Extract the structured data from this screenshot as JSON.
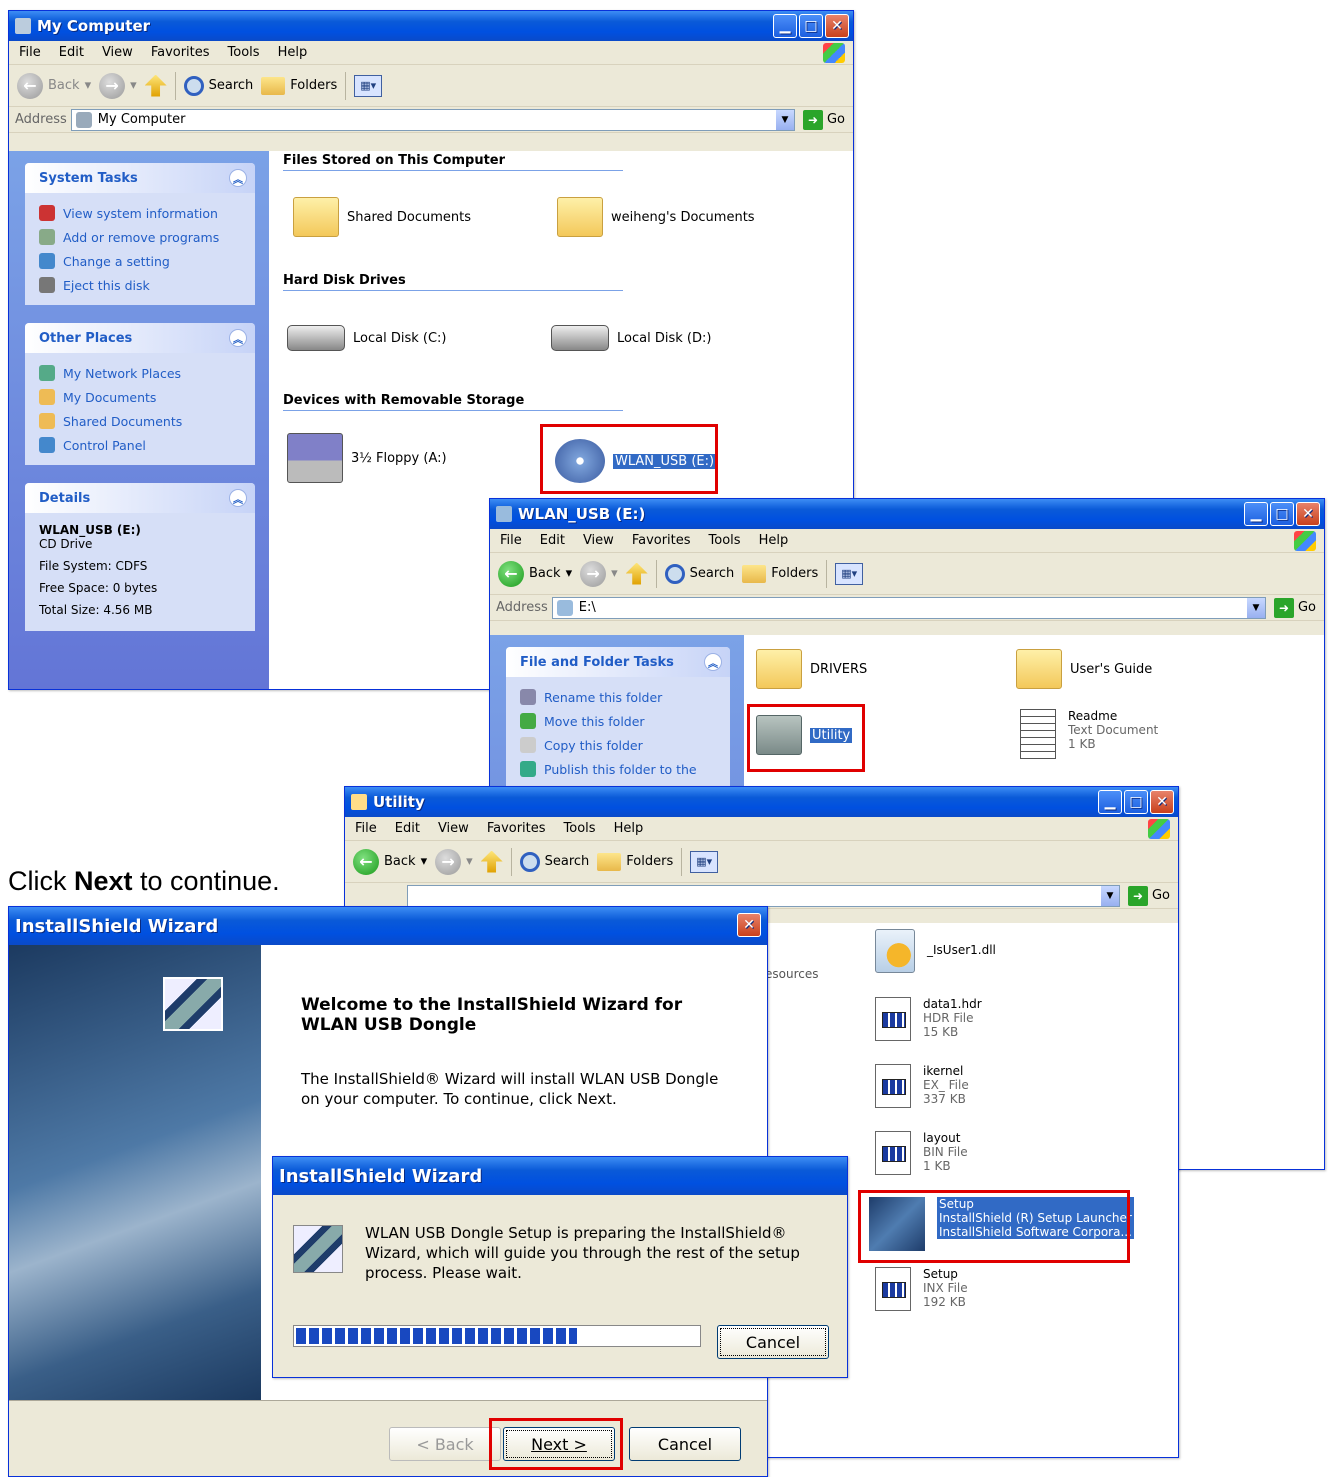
{
  "caption": {
    "pre": "Click ",
    "bold": "Next",
    "post": " to continue."
  },
  "mycomputer": {
    "title": "My Computer",
    "menu": [
      "File",
      "Edit",
      "View",
      "Favorites",
      "Tools",
      "Help"
    ],
    "toolbar": {
      "back": "Back",
      "search": "Search",
      "folders": "Folders"
    },
    "address": {
      "label": "Address",
      "value": "My Computer",
      "go": "Go"
    },
    "system_tasks": {
      "title": "System Tasks",
      "items": [
        "View system information",
        "Add or remove programs",
        "Change a setting",
        "Eject this disk"
      ]
    },
    "other_places": {
      "title": "Other Places",
      "items": [
        "My Network Places",
        "My Documents",
        "Shared Documents",
        "Control Panel"
      ]
    },
    "details": {
      "title": "Details",
      "name": "WLAN_USB (E:)",
      "type": "CD Drive",
      "fs": "File System: CDFS",
      "free": "Free Space: 0 bytes",
      "total": "Total Size: 4.56 MB"
    },
    "sections": {
      "files": "Files Stored on This Computer",
      "hdd": "Hard Disk Drives",
      "removable": "Devices with Removable Storage"
    },
    "items": {
      "shared": "Shared Documents",
      "weiheng": "weiheng's Documents",
      "c": "Local Disk (C:)",
      "d": "Local Disk (D:)",
      "floppy": "3½ Floppy (A:)",
      "wlan": "WLAN_USB (E:)"
    }
  },
  "wlan": {
    "title": "WLAN_USB (E:)",
    "menu": [
      "File",
      "Edit",
      "View",
      "Favorites",
      "Tools",
      "Help"
    ],
    "toolbar": {
      "back": "Back",
      "search": "Search",
      "folders": "Folders"
    },
    "address": {
      "label": "Address",
      "value": "E:\\",
      "go": "Go"
    },
    "tasks": {
      "title": "File and Folder Tasks",
      "items": [
        "Rename this folder",
        "Move this folder",
        "Copy this folder",
        "Publish this folder to the"
      ]
    },
    "items": {
      "drivers": "DRIVERS",
      "guide": "User's Guide",
      "utility": "Utility",
      "readme": "Readme",
      "readme_type": "Text Document",
      "readme_size": "1 KB"
    }
  },
  "utility": {
    "title": "Utility",
    "menu": [
      "File",
      "Edit",
      "View",
      "Favorites",
      "Tools",
      "Help"
    ],
    "toolbar": {
      "back": "Back",
      "search": "Search",
      "folders": "Folders"
    },
    "address": {
      "go": "Go"
    },
    "partial": "esources",
    "files": [
      {
        "name": "_IsUser1.dll",
        "type": "",
        "size": ""
      },
      {
        "name": "data1.hdr",
        "type": "HDR File",
        "size": "15 KB"
      },
      {
        "name": "ikernel",
        "type": "EX_ File",
        "size": "337 KB"
      },
      {
        "name": "layout",
        "type": "BIN File",
        "size": "1 KB"
      },
      {
        "name": "Setup",
        "type": "InstallShield (R) Setup Launcher",
        "size": "InstallShield Software Corpora..."
      },
      {
        "name": "Setup",
        "type": "INX File",
        "size": "192 KB"
      }
    ]
  },
  "wizard": {
    "title": "InstallShield Wizard",
    "heading": "Welcome to the InstallShield Wizard for WLAN USB Dongle",
    "body": "The InstallShield® Wizard will install WLAN USB Dongle on your computer.  To continue, click Next.",
    "back": "< Back",
    "next": "Next >",
    "cancel": "Cancel"
  },
  "progress": {
    "title": "InstallShield Wizard",
    "message": "WLAN USB Dongle Setup is preparing the InstallShield® Wizard, which will guide you through the rest of the setup process. Please wait.",
    "cancel": "Cancel",
    "fraction": 0.7
  }
}
